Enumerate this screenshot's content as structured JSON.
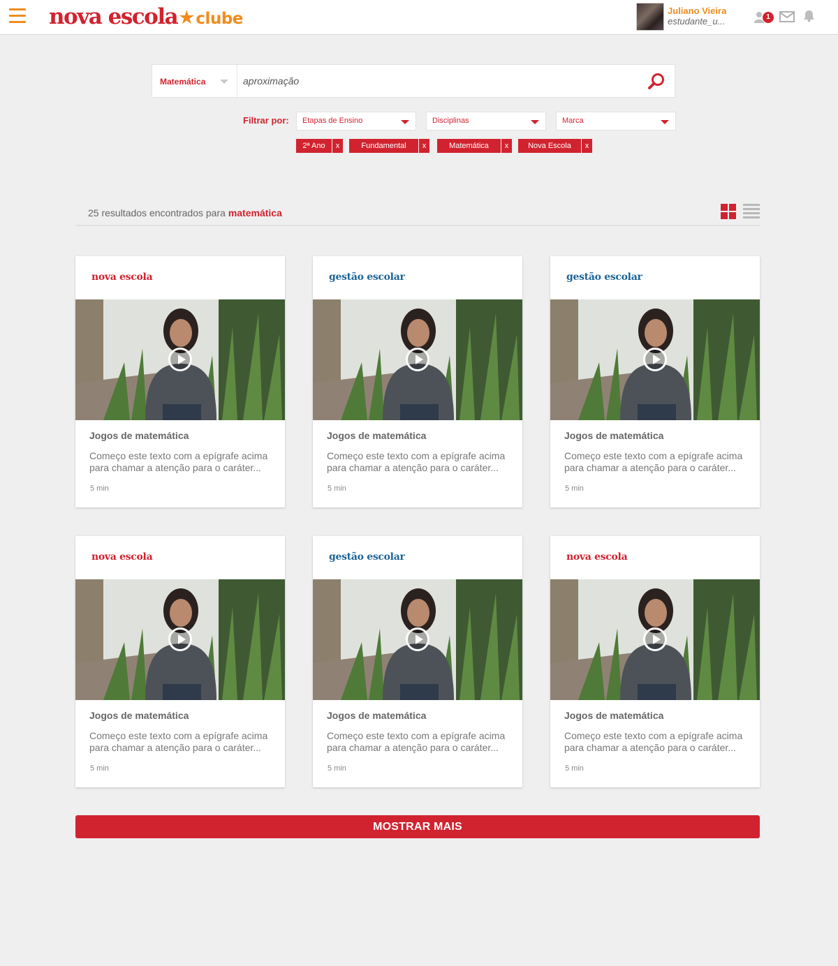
{
  "header": {
    "logo_main": "nova escola",
    "logo_star": "★",
    "logo_club": "clube",
    "user_name": "Juliano Vieira",
    "user_handle": "estudante_u...",
    "friend_requests_count": "1"
  },
  "search": {
    "category": "Matemática",
    "query": "aproximação"
  },
  "filters": {
    "label": "Filtrar por:",
    "dropdowns": [
      "Etapas de Ensino",
      "Disciplinas",
      "Marca"
    ],
    "chips": [
      "2ª Ano",
      "Fundamental",
      "Matemática",
      "Nova Escola"
    ],
    "chip_remove": "x"
  },
  "results": {
    "prefix": "25 resultados encontrados para",
    "term": "matemática"
  },
  "cards": [
    {
      "brand": "nova escola",
      "title": "Jogos de matemática",
      "desc": "Começo este texto com a epígrafe acima para chamar a atenção para o caráter...",
      "time": "5 min"
    },
    {
      "brand": "gestão escolar",
      "title": "Jogos de matemática",
      "desc": "Começo este texto com a epígrafe acima para chamar a atenção para o caráter...",
      "time": "5 min"
    },
    {
      "brand": "gestão escolar",
      "title": "Jogos de matemática",
      "desc": "Começo este texto com a epígrafe acima para chamar a atenção para o caráter...",
      "time": "5 min"
    },
    {
      "brand": "nova escola",
      "title": "Jogos de matemática",
      "desc": "Começo este texto com a epígrafe acima para chamar a atenção para o caráter...",
      "time": "5 min"
    },
    {
      "brand": "gestão escolar",
      "title": "Jogos de matemática",
      "desc": "Começo este texto com a epígrafe acima para chamar a atenção para o caráter...",
      "time": "5 min"
    },
    {
      "brand": "nova escola",
      "title": "Jogos de matemática",
      "desc": "Começo este texto com a epígrafe acima para chamar a atenção para o caráter...",
      "time": "5 min"
    }
  ],
  "show_more": "MOSTRAR MAIS",
  "colors": {
    "brand_red": "#d1232f",
    "brand_orange": "#f08c1e",
    "brand_blue": "#1c6496"
  },
  "icons": {
    "menu": "hamburger-menu-icon",
    "search": "search-icon",
    "friends": "friends-icon",
    "messages": "mail-icon",
    "notifications": "bell-icon",
    "grid_view": "grid-view-icon",
    "list_view": "list-view-icon",
    "play": "play-icon"
  }
}
